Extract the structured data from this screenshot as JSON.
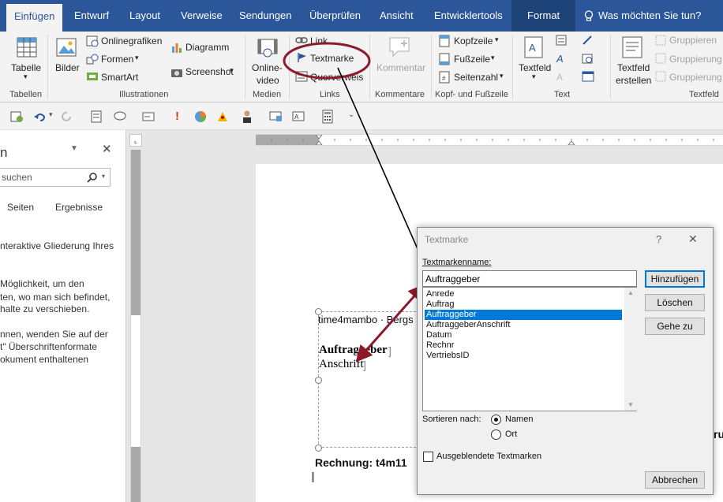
{
  "tabs": {
    "einfuegen": "Einfügen",
    "entwurf": "Entwurf",
    "layout": "Layout",
    "verweise": "Verweise",
    "sendungen": "Sendungen",
    "ueberpruefen": "Überprüfen",
    "ansicht": "Ansicht",
    "entwicklertools": "Entwicklertools",
    "format": "Format",
    "tellme": "Was möchten Sie tun?"
  },
  "ribbon": {
    "tabelle": "Tabelle",
    "bilder": "Bilder",
    "onlinegrafiken": "Onlinegrafiken",
    "formen": "Formen",
    "smartart": "SmartArt",
    "diagramm": "Diagramm",
    "screenshot": "Screenshot",
    "onlinevideo_1": "Online-",
    "onlinevideo_2": "video",
    "link": "Link",
    "textmarke": "Textmarke",
    "querverweis": "Querverweis",
    "kommentar": "Kommentar",
    "kopfzeile": "Kopfzeile",
    "fusszeile": "Fußzeile",
    "seitenzahl": "Seitenzahl",
    "textfeld": "Textfeld",
    "textfeld_erstellen_1": "Textfeld",
    "textfeld_erstellen_2": "erstellen",
    "gruppieren_1": "Gruppieren",
    "gruppieren_2": "Gruppierung",
    "gruppieren_3": "Gruppierung",
    "groups": {
      "tabellen": "Tabellen",
      "illustrationen": "Illustrationen",
      "medien": "Medien",
      "links": "Links",
      "kommentare": "Kommentare",
      "kopf_fuss": "Kopf- und Fußzeile",
      "text": "Text",
      "textfeld": "Textfeld"
    }
  },
  "nav": {
    "title": "n",
    "search_placeholder": "suchen",
    "tab_seiten": "Seiten",
    "tab_ergebnisse": "Ergebnisse",
    "line1": "nteraktive Gliederung Ihres",
    "line2": "Möglichkeit, um den",
    "line3": "ten, wo man sich befindet,",
    "line4": "halte zu verschieben.",
    "line5": "nnen, wenden Sie auf der",
    "line6": "t\" Überschriftenformate",
    "line7": "okument enthaltenen"
  },
  "document": {
    "header_text": "time4mambo · Bergs",
    "auftraggeber": "Auftraggeber",
    "anschrift": "Anschrift",
    "rechnung": "Rechnung: t4m11",
    "right_fragment": "ru"
  },
  "dialog": {
    "title": "Textmarke",
    "help": "?",
    "close": "✕",
    "name_label": "Textmarkenname:",
    "name_value": "Auftraggeber",
    "list": [
      "Anrede",
      "Auftrag",
      "Auftraggeber",
      "AuftraggeberAnschrift",
      "Datum",
      "Rechnr",
      "VertriebsID"
    ],
    "selected_index": 2,
    "btn_add": "Hinzufügen",
    "btn_delete": "Löschen",
    "btn_goto": "Gehe zu",
    "sort_label": "Sortieren nach:",
    "sort_name": "Namen",
    "sort_ort": "Ort",
    "sort_selected": "Namen",
    "hidden_label": "Ausgeblendete Textmarken",
    "hidden_checked": false,
    "btn_cancel": "Abbrechen"
  },
  "colors": {
    "accent": "#2b579a",
    "annotation": "#8b1a2b",
    "selection": "#0078d7"
  }
}
